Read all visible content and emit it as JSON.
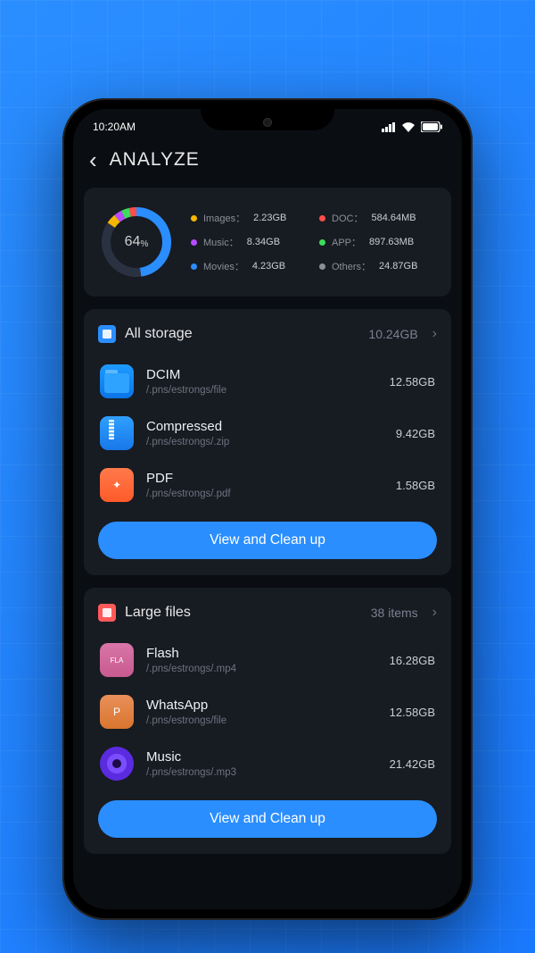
{
  "statusbar": {
    "time": "10:20AM"
  },
  "header": {
    "title": "ANALYZE"
  },
  "chart_data": {
    "type": "pie",
    "title": "",
    "center_value": "64",
    "center_unit": "%",
    "series": [
      {
        "name": "Images",
        "value_label": "2.23GB",
        "color": "#f5b700"
      },
      {
        "name": "Music",
        "value_label": "8.34GB",
        "color": "#b94bff"
      },
      {
        "name": "Movies",
        "value_label": "4.23GB",
        "color": "#2b8eff"
      },
      {
        "name": "DOC",
        "value_label": "584.64MB",
        "color": "#ff4d4d"
      },
      {
        "name": "APP",
        "value_label": "897.63MB",
        "color": "#3ddc5c"
      },
      {
        "name": "Others",
        "value_label": "24.87GB",
        "color": "#8a8f99"
      }
    ]
  },
  "sections": [
    {
      "icon_color": "#2b8eff",
      "title": "All storage",
      "meta": "10.24GB",
      "items": [
        {
          "icon": "folder",
          "name": "DCIM",
          "path": "/.pns/estrongs/file",
          "size": "12.58GB"
        },
        {
          "icon": "zip",
          "name": "Compressed",
          "path": "/.pns/estrongs/.zip",
          "size": "9.42GB"
        },
        {
          "icon": "pdf",
          "name": "PDF",
          "path": "/.pns/estrongs/.pdf",
          "size": "1.58GB"
        }
      ],
      "button": "View and Clean up"
    },
    {
      "icon_color": "#ff5a5a",
      "title": "Large files",
      "meta": "38 items",
      "items": [
        {
          "icon": "fla",
          "name": "Flash",
          "path": "/.pns/estrongs/.mp4",
          "size": "16.28GB"
        },
        {
          "icon": "p",
          "name": "WhatsApp",
          "path": "/.pns/estrongs/file",
          "size": "12.58GB"
        },
        {
          "icon": "music",
          "name": "Music",
          "path": "/.pns/estrongs/.mp3",
          "size": "21.42GB"
        }
      ],
      "button": "View and Clean up"
    }
  ]
}
